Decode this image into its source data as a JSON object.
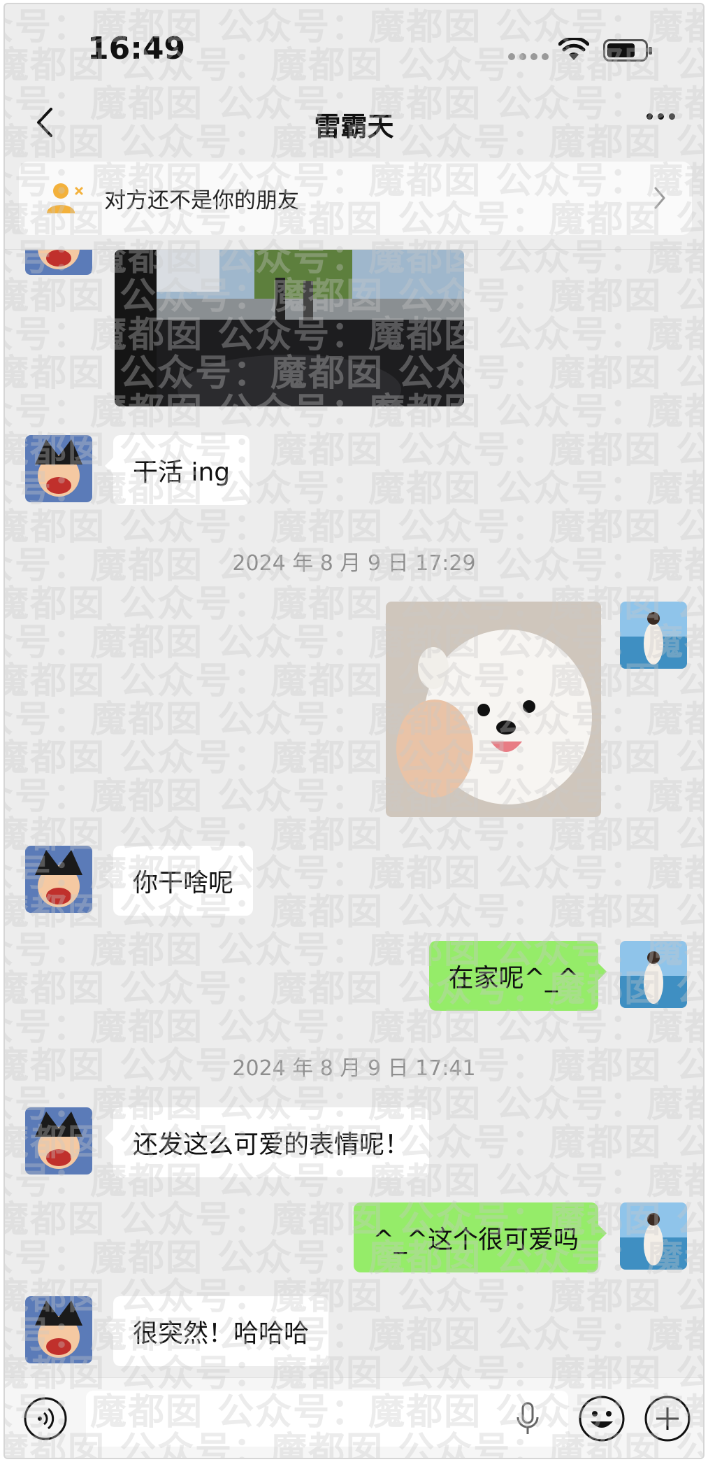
{
  "status_bar": {
    "time": "16:49",
    "battery_level": 0.75
  },
  "nav": {
    "title": "雷霸天"
  },
  "banner": {
    "text": "对方还不是你的朋友"
  },
  "watermark": {
    "text": "众号：魔都囡 公众号：魔都囡 公众号：魔都囡 公众号：魔都囡"
  },
  "messages": [
    {
      "type": "image",
      "from": "other",
      "description": "car-dashboard-photo"
    },
    {
      "type": "text",
      "from": "other",
      "text": "干活 ing"
    },
    {
      "type": "timestamp",
      "text": "2024 年 8 月 9 日 17:29"
    },
    {
      "type": "image",
      "from": "self",
      "description": "white-puppy-sticker"
    },
    {
      "type": "text",
      "from": "other",
      "text": "你干啥呢"
    },
    {
      "type": "text",
      "from": "self",
      "text": "在家呢^_^"
    },
    {
      "type": "timestamp",
      "text": "2024 年 8 月 9 日 17:41"
    },
    {
      "type": "text",
      "from": "other",
      "text": "还发这么可爱的表情呢！"
    },
    {
      "type": "text",
      "from": "self",
      "text": "^_^这个很可爱吗"
    },
    {
      "type": "text",
      "from": "other",
      "text": "很突然！哈哈哈"
    }
  ],
  "input": {
    "placeholder": ""
  },
  "colors": {
    "background": "#ededed",
    "outgoing_bubble": "#95ec69",
    "incoming_bubble": "#ffffff"
  }
}
